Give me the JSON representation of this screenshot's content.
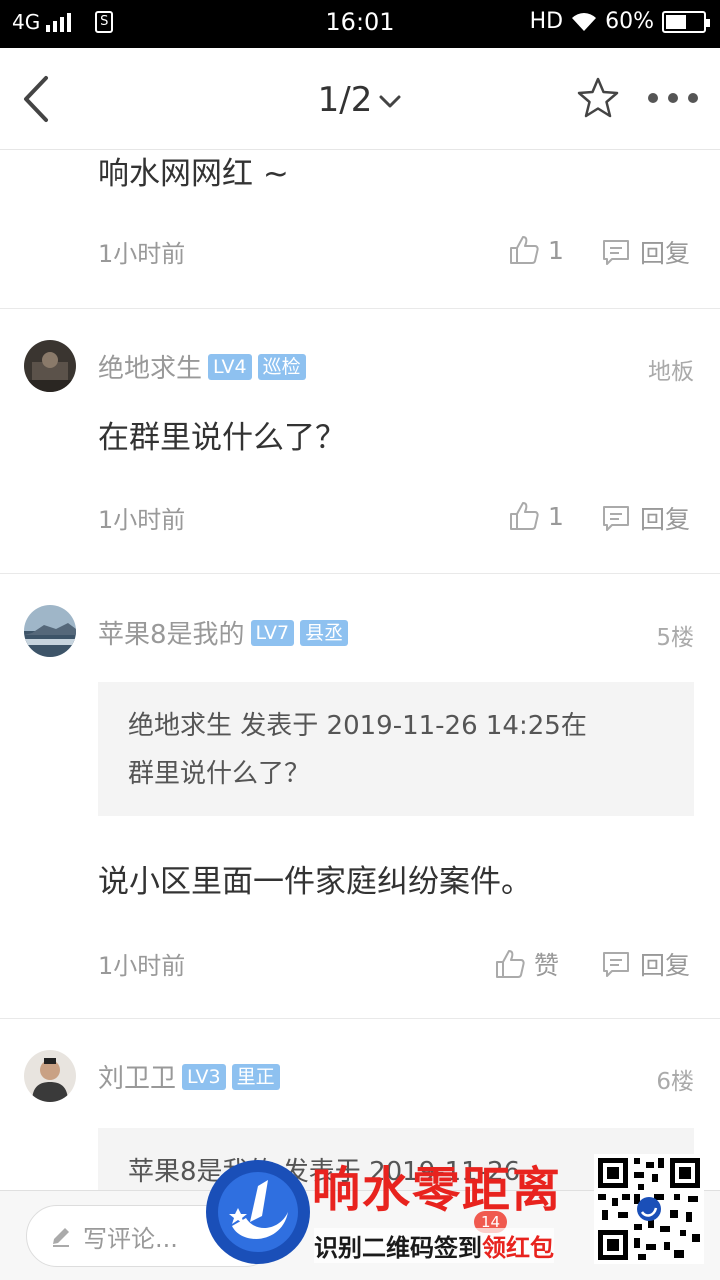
{
  "status_bar": {
    "network": "4G",
    "sim_icon": "S",
    "time": "16:01",
    "hd": "HD",
    "battery": "60%",
    "battery_level": 0.6
  },
  "nav": {
    "page_indicator": "1/2"
  },
  "comments": [
    {
      "content": "响水网网红 ~",
      "time": "1小时前",
      "like_count": "1",
      "reply_label": "回复"
    },
    {
      "username": "绝地求生",
      "level": "LV4",
      "title_badge": "巡检",
      "floor": "地板",
      "content": "在群里说什么了？",
      "time": "1小时前",
      "like_count": "1",
      "reply_label": "回复"
    },
    {
      "username": "苹果8是我的",
      "level": "LV7",
      "title_badge": "县丞",
      "floor": "5楼",
      "quote_line1": "绝地求生 发表于 2019-11-26 14:25在",
      "quote_line2": "群里说什么了？",
      "content": "说小区里面一件家庭纠纷案件。",
      "time": "1小时前",
      "like_label": "赞",
      "reply_label": "回复"
    },
    {
      "username": "刘卫卫",
      "level": "LV3",
      "title_badge": "里正",
      "floor": "6楼",
      "quote_line1": "苹果8是我的 发表于 2019-11-26"
    }
  ],
  "bottom_bar": {
    "comment_placeholder": "写评论...",
    "comment_count": "14"
  },
  "watermark": {
    "title": "响水零距离",
    "subtitle_black": "识别二维码签到",
    "subtitle_red": "领红包"
  },
  "colors": {
    "badge_blue": "#8ec1f0",
    "brand_red": "#e8231e",
    "text_gray": "#999999"
  }
}
